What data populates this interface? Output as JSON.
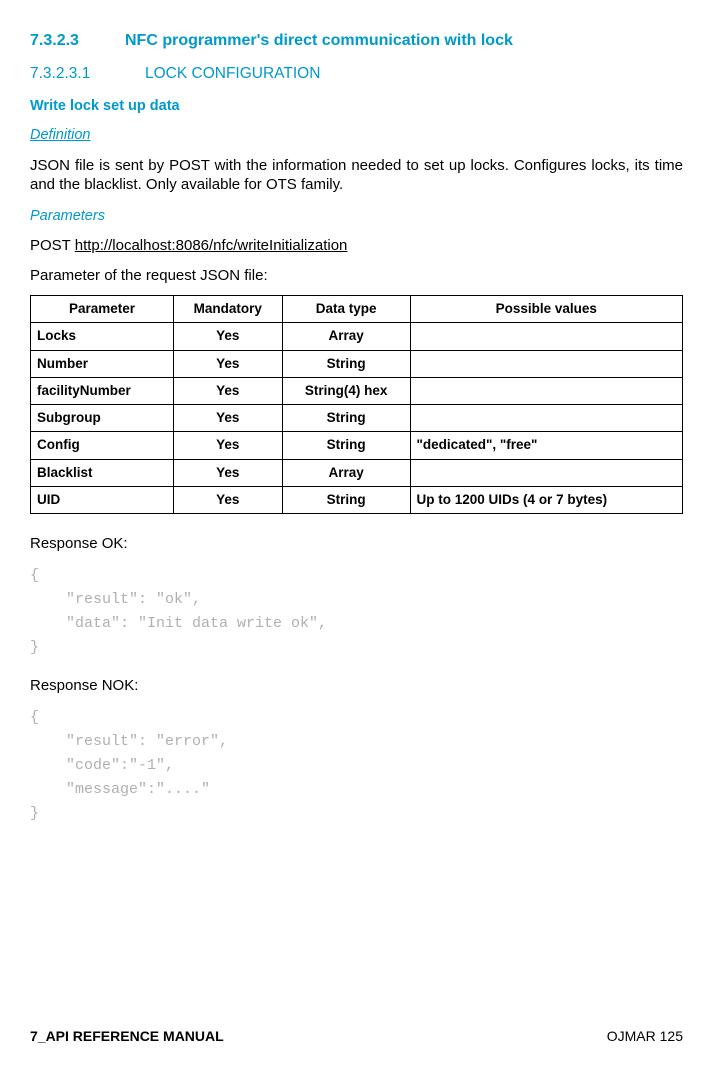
{
  "h3": {
    "num": "7.3.2.3",
    "title": "NFC programmer's direct communication with lock"
  },
  "h4": {
    "num": "7.3.2.3.1",
    "title": "LOCK CONFIGURATION"
  },
  "h5": "Write lock set up data",
  "definition_label": "Definition",
  "definition_body": "JSON file is sent by POST with the information needed to set up locks. Configures locks, its time and the blacklist. Only available for OTS family.",
  "parameters_label": "Parameters",
  "post_prefix": "POST ",
  "post_url": "http://localhost:8086/nfc/writeInitialization",
  "param_intro": "Parameter of the request JSON file:",
  "table": {
    "headers": [
      "Parameter",
      "Mandatory",
      "Data type",
      "Possible values"
    ],
    "rows": [
      {
        "param": "Locks",
        "mandatory": "Yes",
        "type": "Array",
        "vals": ""
      },
      {
        "param": "Number",
        "mandatory": "Yes",
        "type": "String",
        "vals": ""
      },
      {
        "param": "facilityNumber",
        "mandatory": "Yes",
        "type": "String(4) hex",
        "vals": ""
      },
      {
        "param": "Subgroup",
        "mandatory": "Yes",
        "type": "String",
        "vals": ""
      },
      {
        "param": "Config",
        "mandatory": "Yes",
        "type": "String",
        "vals": "\"dedicated\", \"free\""
      },
      {
        "param": "Blacklist",
        "mandatory": "Yes",
        "type": "Array",
        "vals": ""
      },
      {
        "param": "UID",
        "mandatory": "Yes",
        "type": "String",
        "vals": "Up to 1200 UIDs (4 or 7 bytes)"
      }
    ]
  },
  "response_ok_label": "Response OK:",
  "response_ok_code": "{\n    \"result\": \"ok\",\n    \"data\": \"Init data write ok\",\n}",
  "response_nok_label": "Response NOK:",
  "response_nok_code": "{\n    \"result\": \"error\",\n    \"code\":\"-1\",\n    \"message\":\"....\"\n}",
  "footer": {
    "left": "7_API REFERENCE MANUAL",
    "right": "OJMAR 125"
  }
}
